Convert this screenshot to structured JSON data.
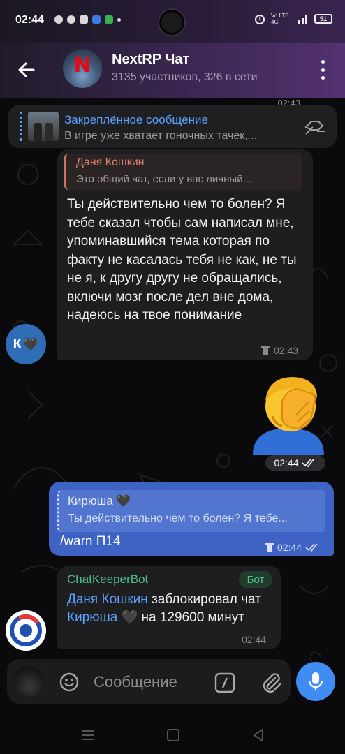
{
  "status_bar": {
    "time": "02:44",
    "network": "Vo LTE 4G",
    "battery": "51"
  },
  "header": {
    "title": "NextRP Чат",
    "subtitle": "3135 участников, 326 в сети",
    "avatar_letter": "N",
    "back_icon": "arrow-left-icon",
    "menu_icon": "more-vertical-icon"
  },
  "pinned": {
    "title": "Закреплённое сообщение",
    "text": "В игре уже хватает гоночных тачек,...",
    "icon": "unpin-icon"
  },
  "time_peek": "02:43",
  "messages": {
    "incoming": {
      "reply_name": "Даня Кошкин",
      "reply_text": "Это общий чат, если у вас личный...",
      "text": "Ты действительно чем то болен? Я тебе сказал чтобы сам написал мне, упоминавшийся тема которая по факту не касалась тебя не как, не ты не я, к другу другу не обращались, включи мозг после дел вне дома, надеюсь на твое понимание",
      "time": "02:43",
      "avatar_letter": "К",
      "avatar_emoji": "🖤"
    },
    "sticker": {
      "emoji": "facepalm",
      "time": "02:44"
    },
    "outgoing": {
      "reply_name": "Кирюша 🖤",
      "reply_text": "Ты действительно чем то болен? Я тебе...",
      "text": "/warn П14",
      "time": "02:44"
    },
    "bot": {
      "name": "ChatKeeperBot",
      "badge": "Бот",
      "mention1": "Даня Кошкин",
      "text_part1": " заблокировал чат ",
      "mention2": "Кирюша 🖤",
      "text_part2": " на 129600 минут",
      "time": "02:44"
    }
  },
  "composer": {
    "placeholder": "Сообщение"
  },
  "colors": {
    "accent": "#3f8cf2",
    "outgoing_bubble": "#3e63c4",
    "incoming_bubble": "#1e1e21",
    "bot_name": "#4cc38a",
    "reply_name": "#e0806c"
  }
}
